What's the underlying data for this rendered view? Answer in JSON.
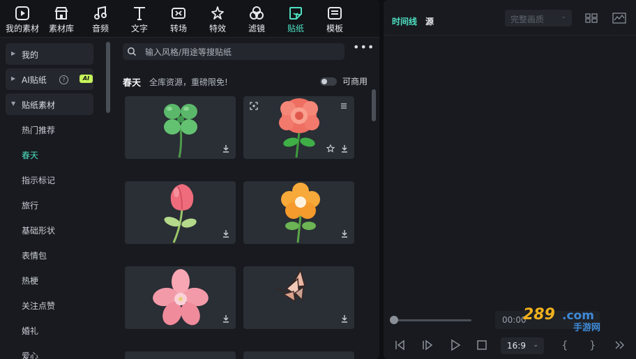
{
  "toolbar": {
    "items": [
      {
        "label": "我的素材",
        "icon": "my-media-icon",
        "active": false
      },
      {
        "label": "素材库",
        "icon": "store-icon",
        "active": false
      },
      {
        "label": "音频",
        "icon": "music-note-icon",
        "active": false
      },
      {
        "label": "文字",
        "icon": "text-t-icon",
        "active": false
      },
      {
        "label": "转场",
        "icon": "transition-icon",
        "active": false
      },
      {
        "label": "特效",
        "icon": "effects-star-icon",
        "active": false
      },
      {
        "label": "滤镜",
        "icon": "filter-icon",
        "active": false
      },
      {
        "label": "贴纸",
        "icon": "sticker-icon",
        "active": true
      },
      {
        "label": "模板",
        "icon": "template-icon",
        "active": false
      }
    ]
  },
  "sidebar": {
    "heads": [
      {
        "label": "我的",
        "expanded": false
      },
      {
        "label": "AI贴纸",
        "expanded": false,
        "badge": "AI",
        "help": "?"
      },
      {
        "label": "贴纸素材",
        "expanded": true
      }
    ],
    "subitems": [
      "热门推荐",
      "春天",
      "指示标记",
      "旅行",
      "基础形状",
      "表情包",
      "热梗",
      "关注点赞",
      "婚礼",
      "爱心"
    ],
    "active_subitem": "春天"
  },
  "content": {
    "search_placeholder": "输入风格/用途等搜贴纸",
    "more_label": "•••",
    "category_title": "春天",
    "category_desc": "全库资源，重磅限免!",
    "commercial_label": "可商用",
    "commercial_on": false,
    "stickers": [
      {
        "name": "clover",
        "icons": [
          "download-icon"
        ]
      },
      {
        "name": "rose",
        "icons": [
          "download-icon",
          "star-icon",
          "scan-icon",
          "menu-icon"
        ]
      },
      {
        "name": "tulip",
        "icons": [
          "download-icon"
        ]
      },
      {
        "name": "orange-flower",
        "icons": [
          "download-icon"
        ]
      },
      {
        "name": "pink-blossom",
        "icons": [
          "download-icon"
        ]
      },
      {
        "name": "butterfly",
        "icons": [
          "download-icon"
        ]
      }
    ]
  },
  "preview": {
    "tab_timeline": "时间线",
    "tab_source": "源",
    "quality": "完整画质",
    "timecode": "00:00",
    "aspect_ratio": "16:9",
    "brace_open": "{",
    "brace_close": "}",
    "watermark": "289.com 手游网",
    "accent_color": "#4fe0c2"
  }
}
